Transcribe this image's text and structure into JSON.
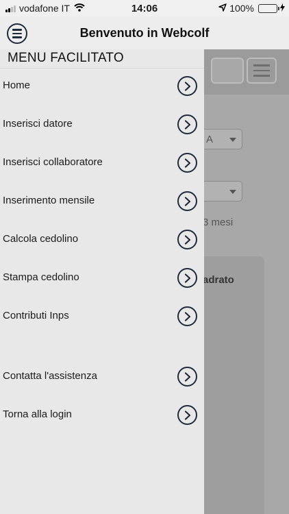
{
  "status_bar": {
    "carrier": "vodafone IT",
    "time": "14:06",
    "battery": "100%"
  },
  "header": {
    "title": "Benvenuto in Webcolf"
  },
  "drawer": {
    "title": "MENU FACILITATO",
    "items": [
      {
        "label": "Home"
      },
      {
        "label": "Inserisci datore"
      },
      {
        "label": "Inserisci collaboratore"
      },
      {
        "label": "Inserimento mensile"
      },
      {
        "label": "Calcola cedolino"
      },
      {
        "label": "Stampa cedolino"
      },
      {
        "label": "Contributi Inps"
      },
      {
        "label": "Contatta l'assistenza"
      },
      {
        "label": "Torna alla login"
      }
    ]
  },
  "background": {
    "select1_value": "A",
    "note": "3 mesi",
    "card_title": "adrato"
  },
  "colors": {
    "accent_icon": "#1f2a3a",
    "battery_green": "#4cd964"
  }
}
